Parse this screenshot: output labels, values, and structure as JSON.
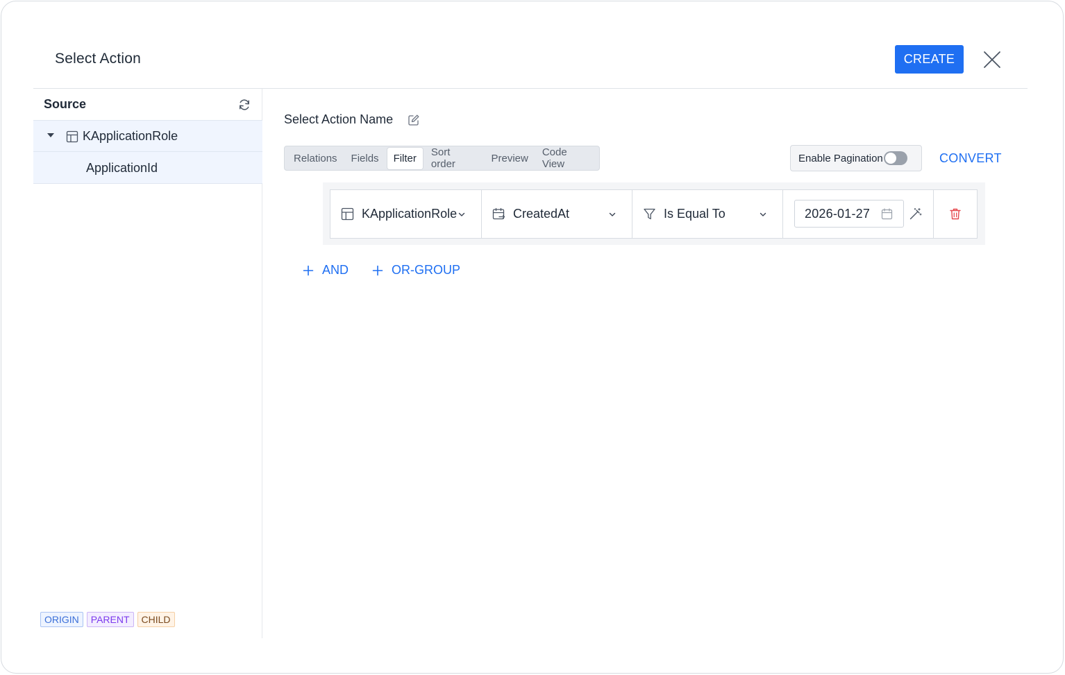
{
  "dialog": {
    "title": "Select Action",
    "create_label": "CREATE"
  },
  "source": {
    "title": "Source",
    "tree": {
      "root_label": "KApplicationRole",
      "children": [
        "ApplicationId"
      ]
    },
    "legend": [
      "ORIGIN",
      "PARENT",
      "CHILD"
    ]
  },
  "main": {
    "action_name": "Select Action Name",
    "tabs": [
      {
        "label": "Relations",
        "active": false
      },
      {
        "label": "Fields",
        "active": false
      },
      {
        "label": "Filter",
        "active": true
      },
      {
        "label": "Sort order",
        "active": false
      },
      {
        "label": "Preview",
        "active": false
      },
      {
        "label": "Code View",
        "active": false
      }
    ],
    "pagination_label": "Enable Pagination",
    "pagination_enabled": false,
    "convert_label": "CONVERT",
    "filter": {
      "table": "KApplicationRole",
      "field": "CreatedAt",
      "operator": "Is Equal To",
      "value": "2026-01-27"
    },
    "add_and_label": "AND",
    "add_or_group_label": "OR-GROUP"
  },
  "colors": {
    "accent": "#1f6ff2",
    "delete": "#e5484d",
    "tree_selected_bg": "#f0f5fe"
  },
  "icons": [
    "close-icon",
    "refresh-icon",
    "table-icon",
    "edit-icon",
    "calendar-field-icon",
    "filter-icon",
    "chevron-down-icon",
    "calendar-icon",
    "magic-wand-icon",
    "trash-icon",
    "plus-icon"
  ]
}
